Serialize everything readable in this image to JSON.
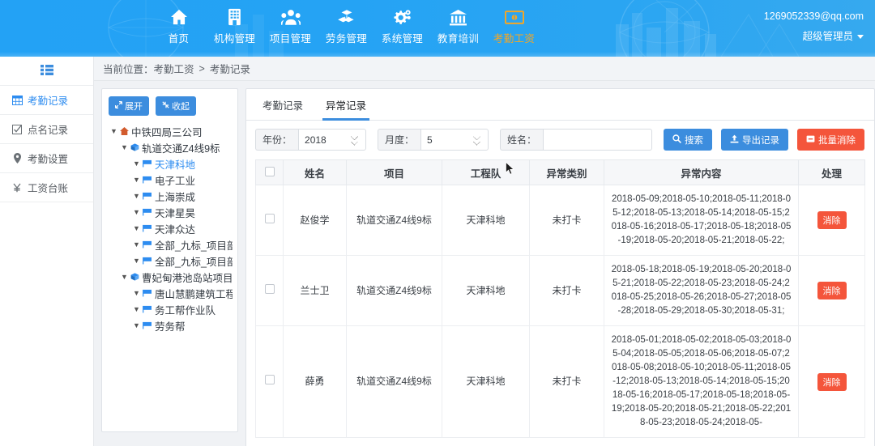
{
  "header": {
    "nav": [
      {
        "label": "首页",
        "icon": "home-icon",
        "active": false
      },
      {
        "label": "机构管理",
        "icon": "building-icon",
        "active": false
      },
      {
        "label": "项目管理",
        "icon": "people-icon",
        "active": false
      },
      {
        "label": "劳务管理",
        "icon": "blocks-icon",
        "active": false
      },
      {
        "label": "系统管理",
        "icon": "gears-icon",
        "active": false
      },
      {
        "label": "教育培训",
        "icon": "bank-icon",
        "active": false
      },
      {
        "label": "考勤工资",
        "icon": "money-icon",
        "active": true
      }
    ],
    "email": "1269052339@qq.com",
    "username": "超级管理员",
    "brand_color": "#27a4f2",
    "active_color": "#f5a623"
  },
  "sidebar": {
    "toggle_icon": "list-menu-icon",
    "items": [
      {
        "label": "考勤记录",
        "icon": "table-icon",
        "active": true
      },
      {
        "label": "点名记录",
        "icon": "check-square-icon",
        "active": false
      },
      {
        "label": "考勤设置",
        "icon": "map-pin-icon",
        "active": false
      },
      {
        "label": "工资台账",
        "icon": "yen-icon",
        "active": false
      }
    ]
  },
  "breadcrumb": {
    "prefix": "当前位置：",
    "parent": "考勤工资",
    "separator": ">",
    "current": "考勤记录"
  },
  "tree_panel": {
    "expand_label": "展开",
    "collapse_label": "收起",
    "expand_icon": "expand-arrows-icon",
    "collapse_icon": "collapse-arrows-icon",
    "nodes": [
      {
        "label": "中铁四局三公司",
        "level": 1,
        "icon": "home-node-icon",
        "selected": false
      },
      {
        "label": "轨道交通Z4线9标",
        "level": 2,
        "icon": "cube-node-icon",
        "selected": false
      },
      {
        "label": "天津科地",
        "level": 3,
        "icon": "flag-node-icon",
        "selected": true
      },
      {
        "label": "电子工业",
        "level": 3,
        "icon": "flag-node-icon",
        "selected": false
      },
      {
        "label": "上海崇成",
        "level": 3,
        "icon": "flag-node-icon",
        "selected": false
      },
      {
        "label": "天津星昊",
        "level": 3,
        "icon": "flag-node-icon",
        "selected": false
      },
      {
        "label": "天津众达",
        "level": 3,
        "icon": "flag-node-icon",
        "selected": false
      },
      {
        "label": "全部_九标_项目部_工",
        "level": 3,
        "icon": "flag-node-icon",
        "selected": false
      },
      {
        "label": "全部_九标_项目部_安",
        "level": 3,
        "icon": "flag-node-icon",
        "selected": false
      },
      {
        "label": "曹妃甸港池岛站项目",
        "level": 2,
        "icon": "cube-node-icon",
        "selected": false
      },
      {
        "label": "唐山慧鹏建筑工程有",
        "level": 3,
        "icon": "flag-node-icon",
        "selected": false
      },
      {
        "label": "务工帮作业队",
        "level": 3,
        "icon": "flag-node-icon",
        "selected": false
      },
      {
        "label": "劳务帮",
        "level": 3,
        "icon": "flag-node-icon",
        "selected": false
      }
    ]
  },
  "tabs": [
    {
      "label": "考勤记录",
      "active": false
    },
    {
      "label": "异常记录",
      "active": true
    }
  ],
  "filters": {
    "year_label": "年份：",
    "year_value": "2018",
    "month_label": "月度：",
    "month_value": "5",
    "name_label": "姓名：",
    "name_value": "",
    "name_placeholder": "",
    "search_label": "搜索",
    "search_icon": "search-icon",
    "export_label": "导出记录",
    "export_icon": "upload-icon",
    "batch_clear_label": "批量消除",
    "batch_clear_icon": "minus-box-icon",
    "primary_color": "#3c8dde",
    "danger_color": "#f4553b"
  },
  "table": {
    "columns": [
      "",
      "姓名",
      "项目",
      "工程队",
      "异常类别",
      "异常内容",
      "处理"
    ],
    "action_label": "消除",
    "rows": [
      {
        "name": "赵俊学",
        "project": "轨道交通Z4线9标",
        "team": "天津科地",
        "type": "未打卡",
        "content": "2018-05-09;2018-05-10;2018-05-11;2018-05-12;2018-05-13;2018-05-14;2018-05-15;2018-05-16;2018-05-17;2018-05-18;2018-05-19;2018-05-20;2018-05-21;2018-05-22;"
      },
      {
        "name": "兰士卫",
        "project": "轨道交通Z4线9标",
        "team": "天津科地",
        "type": "未打卡",
        "content": "2018-05-18;2018-05-19;2018-05-20;2018-05-21;2018-05-22;2018-05-23;2018-05-24;2018-05-25;2018-05-26;2018-05-27;2018-05-28;2018-05-29;2018-05-30;2018-05-31;"
      },
      {
        "name": "薛勇",
        "project": "轨道交通Z4线9标",
        "team": "天津科地",
        "type": "未打卡",
        "content": "2018-05-01;2018-05-02;2018-05-03;2018-05-04;2018-05-05;2018-05-06;2018-05-07;2018-05-08;2018-05-10;2018-05-11;2018-05-12;2018-05-13;2018-05-14;2018-05-15;2018-05-16;2018-05-17;2018-05-18;2018-05-19;2018-05-20;2018-05-21;2018-05-22;2018-05-23;2018-05-24;2018-05-"
      }
    ]
  }
}
